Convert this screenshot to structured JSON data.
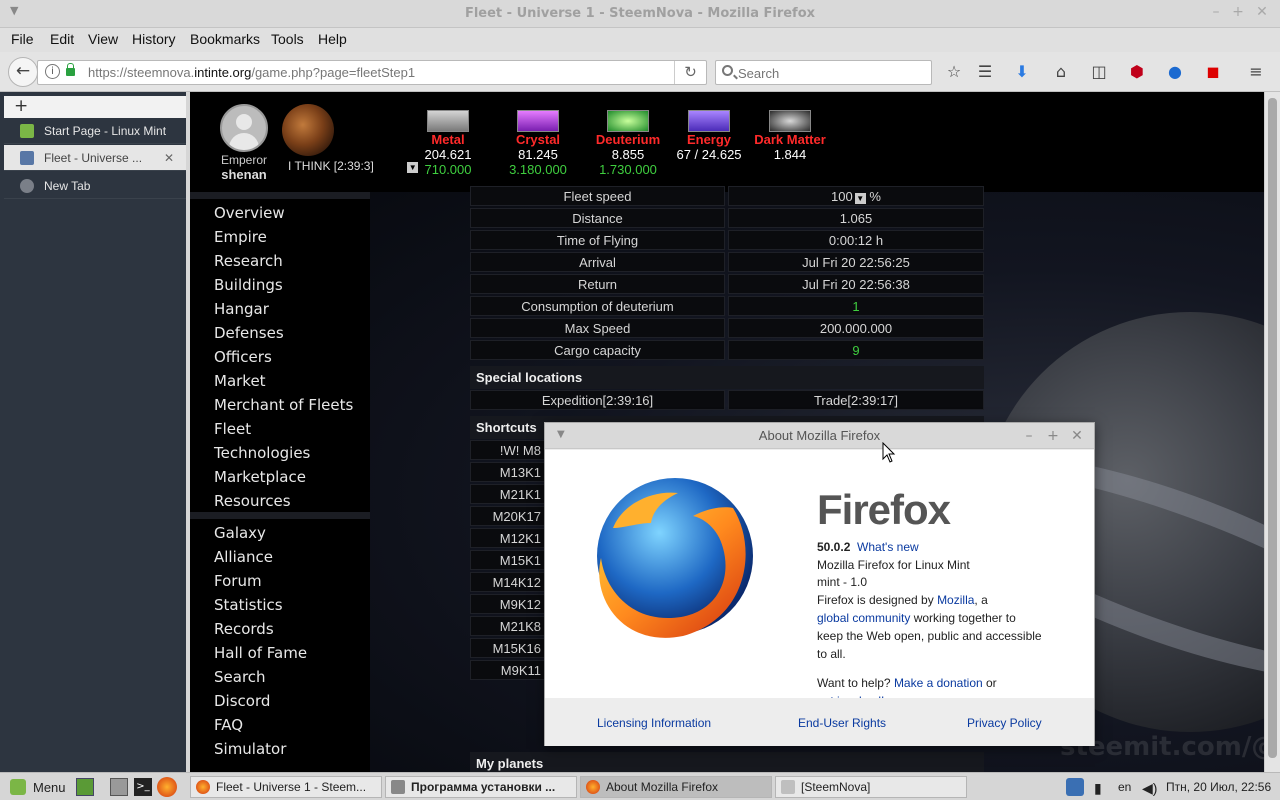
{
  "window": {
    "title": "Fleet - Universe 1 - SteemNova - Mozilla Firefox"
  },
  "menubar": [
    "File",
    "Edit",
    "View",
    "History",
    "Bookmarks",
    "Tools",
    "Help"
  ],
  "nav": {
    "url_prefix": "https://steemnova.",
    "url_domain": "intinte.org",
    "url_path": "/game.php?page=fleetStep1",
    "search_placeholder": "Search"
  },
  "tabs": [
    {
      "label": "Start Page - Linux Mint",
      "active": false
    },
    {
      "label": "Fleet - Universe ...",
      "active": true
    },
    {
      "label": "New Tab",
      "active": false
    }
  ],
  "player": {
    "rank": "Emperor",
    "name": "shenan",
    "planet": "I THINK [2:39:3]"
  },
  "resources": [
    {
      "name": "Metal",
      "value": "204.621",
      "prod": "710.000",
      "color": "#ff2a2a"
    },
    {
      "name": "Crystal",
      "value": "81.245",
      "prod": "3.180.000",
      "color": "#ff2a2a"
    },
    {
      "name": "Deuterium",
      "value": "8.855",
      "prod": "1.730.000",
      "color": "#ff2a2a"
    },
    {
      "name": "Energy",
      "value": "67 / 24.625",
      "prod": "",
      "color": "#ff2a2a"
    },
    {
      "name": "Dark Matter",
      "value": "1.844",
      "prod": "",
      "color": "#ff2a2a"
    }
  ],
  "game_menu": [
    "Overview",
    "Empire",
    "Research",
    "Buildings",
    "Hangar",
    "Defenses",
    "Officers",
    "Market",
    "Merchant of Fleets",
    "Fleet",
    "Technologies",
    "Marketplace",
    "Resources",
    "Galaxy",
    "Alliance",
    "Forum",
    "Statistics",
    "Records",
    "Hall of Fame",
    "Search",
    "Discord",
    "FAQ",
    "Simulator"
  ],
  "fleet": {
    "speed_label": "Fleet speed",
    "speed_value": "100",
    "speed_unit": "%",
    "rows": [
      {
        "label": "Distance",
        "value": "1.065",
        "green": false
      },
      {
        "label": "Time of Flying",
        "value": "0:00:12 h",
        "green": false
      },
      {
        "label": "Arrival",
        "value": "Jul Fri 20 22:56:25",
        "green": false
      },
      {
        "label": "Return",
        "value": "Jul Fri 20 22:56:38",
        "green": false
      },
      {
        "label": "Consumption of deuterium",
        "value": "1",
        "green": true
      },
      {
        "label": "Max Speed",
        "value": "200.000.000",
        "green": false
      },
      {
        "label": "Cargo capacity",
        "value": "9",
        "green": true
      }
    ],
    "special_header": "Special locations",
    "special_left": "Expedition[2:39:16]",
    "special_right": "Trade[2:39:17]",
    "shortcuts_header": "Shortcuts",
    "shortcuts": [
      "!W! M8",
      "M13K1",
      "M21K1",
      "M20K17",
      "M12K1",
      "M15K1",
      "M14K12",
      "M9K12",
      "M21K8",
      "M15K16",
      "M9K11"
    ],
    "planets_header": "My planets"
  },
  "about": {
    "title": "About Mozilla Firefox",
    "wordmark": "Firefox",
    "version": "50.0.2",
    "whats_new": "What's new",
    "line_product": "Mozilla Firefox for Linux Mint",
    "line_build": "mint - 1.0",
    "designed_pre": "Firefox is designed by ",
    "mozilla": "Mozilla",
    "designed_post": ", a",
    "global_community": "global community",
    "working": " working together to",
    "keep": "keep the Web open, public and accessible",
    "to_all": "to all.",
    "help_pre": "Want to help? ",
    "donation": "Make a donation",
    "or": " or",
    "get_involved": "get involved!",
    "licensing": "Licensing Information",
    "eula": "End-User Rights",
    "privacy": "Privacy Policy"
  },
  "watermark": "steemit.com/@mh",
  "taskbar": {
    "menu": "Menu",
    "windows": [
      {
        "label": "Fleet - Universe 1 - Steem...",
        "active": false
      },
      {
        "label": "Программа установки ...",
        "active": false
      },
      {
        "label": "About Mozilla Firefox",
        "active": true
      },
      {
        "label": "[SteemNova]",
        "active": false
      }
    ],
    "lang": "en",
    "clock": "Птн, 20 Июл, 22:56"
  }
}
